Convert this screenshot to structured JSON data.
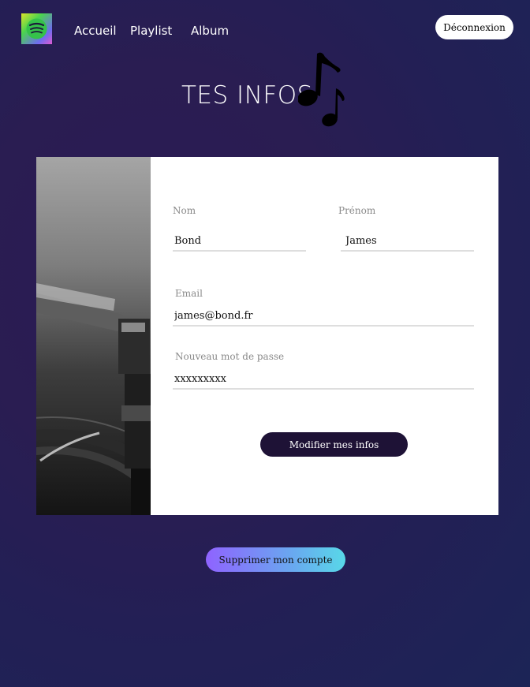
{
  "header": {
    "logo_icon": "spotify-logo-icon",
    "nav": [
      {
        "label": "Accueil"
      },
      {
        "label": "Playlist"
      },
      {
        "label": "Album"
      }
    ],
    "logout_label": "Déconnexion"
  },
  "page": {
    "title": "TES INFOS",
    "title_icon": "music-note-icon"
  },
  "form": {
    "image_icon": "turntable-image",
    "nom": {
      "label": "Nom",
      "value": "Bond"
    },
    "prenom": {
      "label": "Prénom",
      "value": "James"
    },
    "email": {
      "label": "Email",
      "value": "james@bond.fr"
    },
    "password": {
      "label": "Nouveau mot de passe",
      "value": "xxxxxxxxx"
    },
    "submit_label": "Modifier mes infos"
  },
  "delete_label": "Supprimer mon compte",
  "colors": {
    "submit_bg": "#1e1236",
    "delete_gradient_start": "#8f63ff",
    "delete_gradient_end": "#58d8e8"
  }
}
